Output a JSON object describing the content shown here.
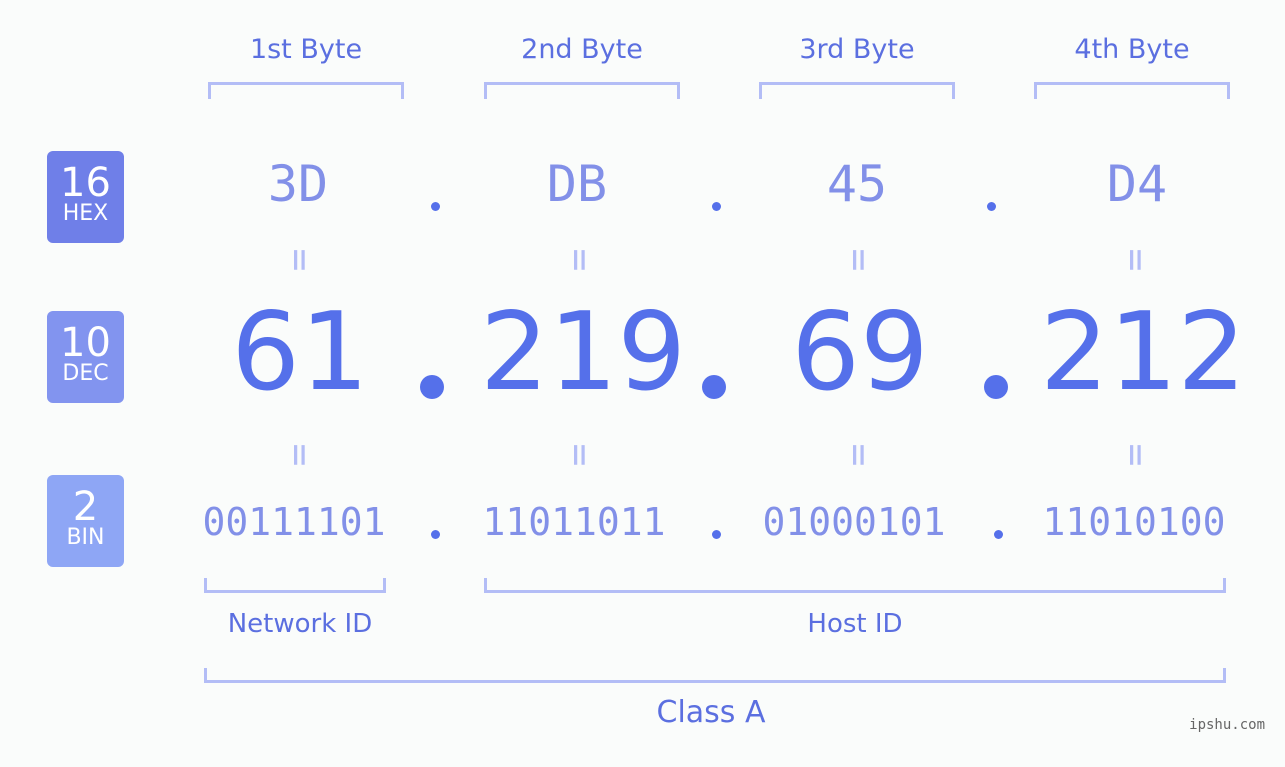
{
  "byte_headers": [
    "1st Byte",
    "2nd Byte",
    "3rd Byte",
    "4th Byte"
  ],
  "badges": {
    "hex": {
      "num": "16",
      "label": "HEX",
      "color": "#6f7fe8"
    },
    "dec": {
      "num": "10",
      "label": "DEC",
      "color": "#8294ef"
    },
    "bin": {
      "num": "2",
      "label": "BIN",
      "color": "#8ea6f5"
    }
  },
  "hex": [
    "3D",
    "DB",
    "45",
    "D4"
  ],
  "dec": [
    "61",
    "219",
    "69",
    "212"
  ],
  "bin": [
    "00111101",
    "11011011",
    "01000101",
    "11010100"
  ],
  "equals_sign": "=",
  "network_id_label": "Network ID",
  "host_id_label": "Host ID",
  "class_label": "Class A",
  "watermark": "ipshu.com"
}
